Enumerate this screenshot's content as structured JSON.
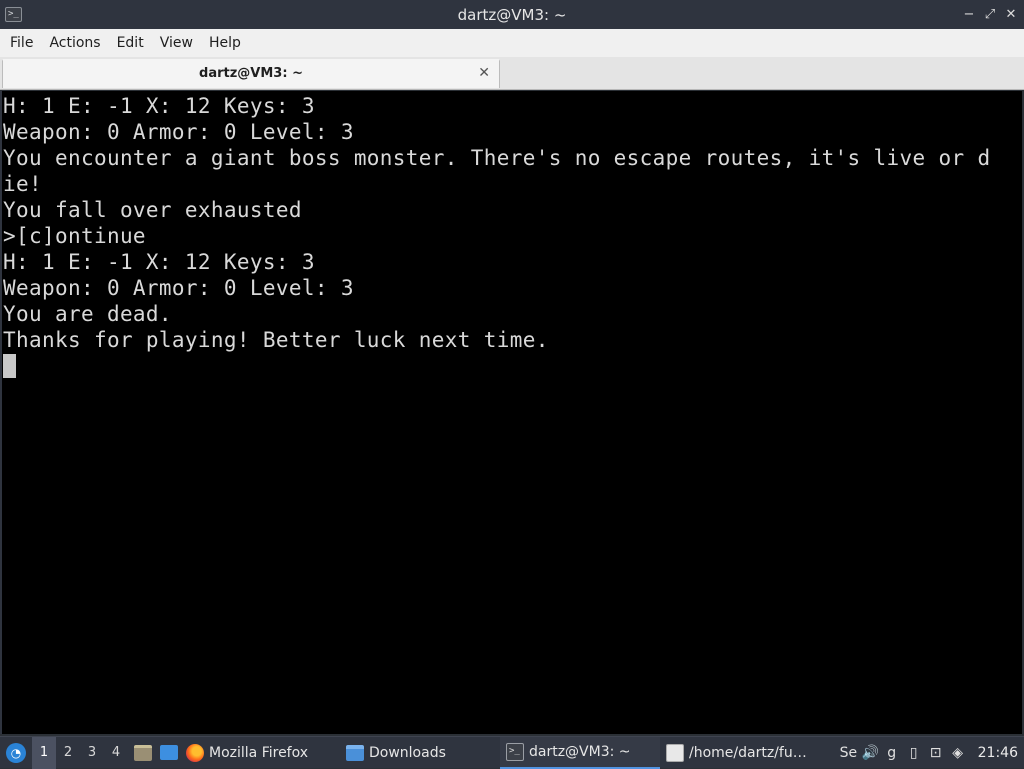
{
  "window": {
    "title": "dartz@VM3: ~",
    "minimize": "−",
    "maximize": "⤢",
    "close": "✕",
    "app_icon": ">_"
  },
  "menu": {
    "items": [
      "File",
      "Actions",
      "Edit",
      "View",
      "Help"
    ]
  },
  "tab": {
    "label": "dartz@VM3: ~",
    "close": "✕"
  },
  "terminal": {
    "lines": [
      "H: 1 E: -1 X: 12 Keys: 3",
      "Weapon: 0 Armor: 0 Level: 3",
      "You encounter a giant boss monster. There's no escape routes, it's live or d",
      "ie!",
      "You fall over exhausted",
      ">[c]ontinue",
      "H: 1 E: -1 X: 12 Keys: 3",
      "Weapon: 0 Armor: 0 Level: 3",
      "You are dead.",
      "Thanks for playing! Better luck next time."
    ]
  },
  "taskbar": {
    "workspaces": [
      "1",
      "2",
      "3",
      "4"
    ],
    "active_workspace": "1",
    "tasks": [
      {
        "label": "Mozilla Firefox",
        "icon": "firefox-icon"
      },
      {
        "label": "Downloads",
        "icon": "folder-icon"
      },
      {
        "label": "dartz@VM3: ~",
        "icon": "terminal-icon"
      },
      {
        "label": "/home/dartz/fu…",
        "icon": "text-editor-icon"
      }
    ],
    "tray": {
      "partial_labels": [
        "Se",
        "g"
      ],
      "clock": "21:46"
    }
  },
  "colors": {
    "titlebar": "#2f343f",
    "terminal_bg": "#000000",
    "terminal_fg": "#d9d9d9",
    "taskbar": "#2f343f",
    "accent": "#5294e2"
  }
}
